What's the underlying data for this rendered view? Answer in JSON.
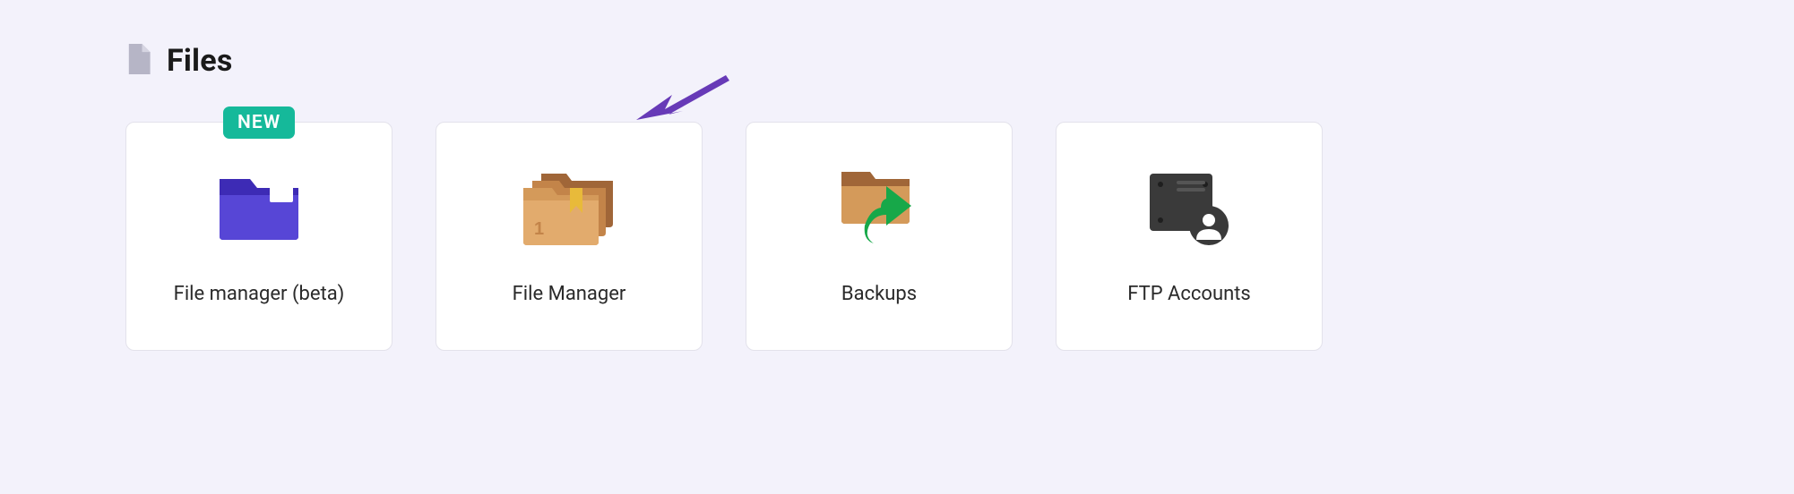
{
  "section": {
    "title": "Files",
    "badge_new": "NEW",
    "cards": [
      {
        "label": "File manager (beta)"
      },
      {
        "label": "File Manager"
      },
      {
        "label": "Backups"
      },
      {
        "label": "FTP Accounts"
      }
    ]
  }
}
